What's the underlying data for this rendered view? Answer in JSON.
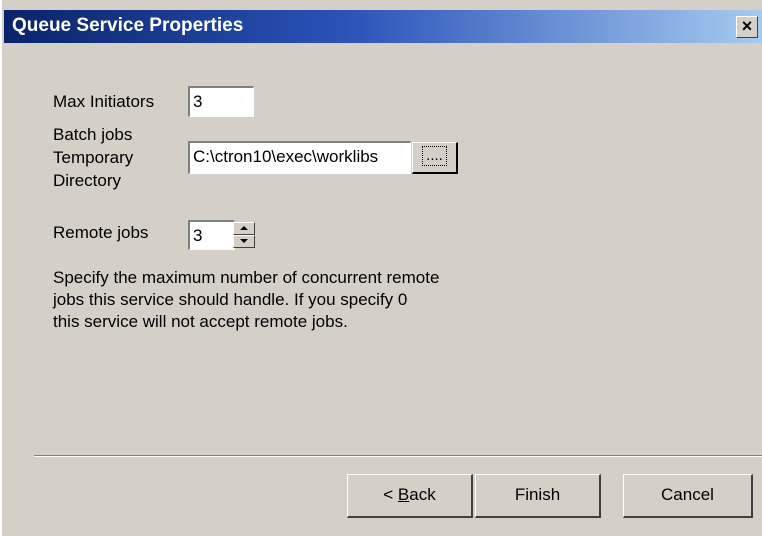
{
  "window": {
    "title": "Queue Service Properties",
    "close_label": "×"
  },
  "form": {
    "max_initiators_label": "Max Initiators",
    "max_initiators_value": "3",
    "batch_label_line1": "Batch jobs",
    "batch_label_line2": "Temporary",
    "batch_label_line3": "Directory",
    "batch_dir_value": "C:\\ctron10\\exec\\worklibs",
    "browse_label": "....",
    "remote_jobs_label": "Remote jobs",
    "remote_jobs_value": "3"
  },
  "help": {
    "line1": "Specify the maximum number of concurrent  remote",
    "line2": "jobs this service should handle.   If you specify 0",
    "line3": "this service will not accept remote jobs."
  },
  "buttons": {
    "back_prefix": "< ",
    "back_accel": "B",
    "back_rest": "ack",
    "finish": "Finish",
    "cancel": "Cancel"
  }
}
